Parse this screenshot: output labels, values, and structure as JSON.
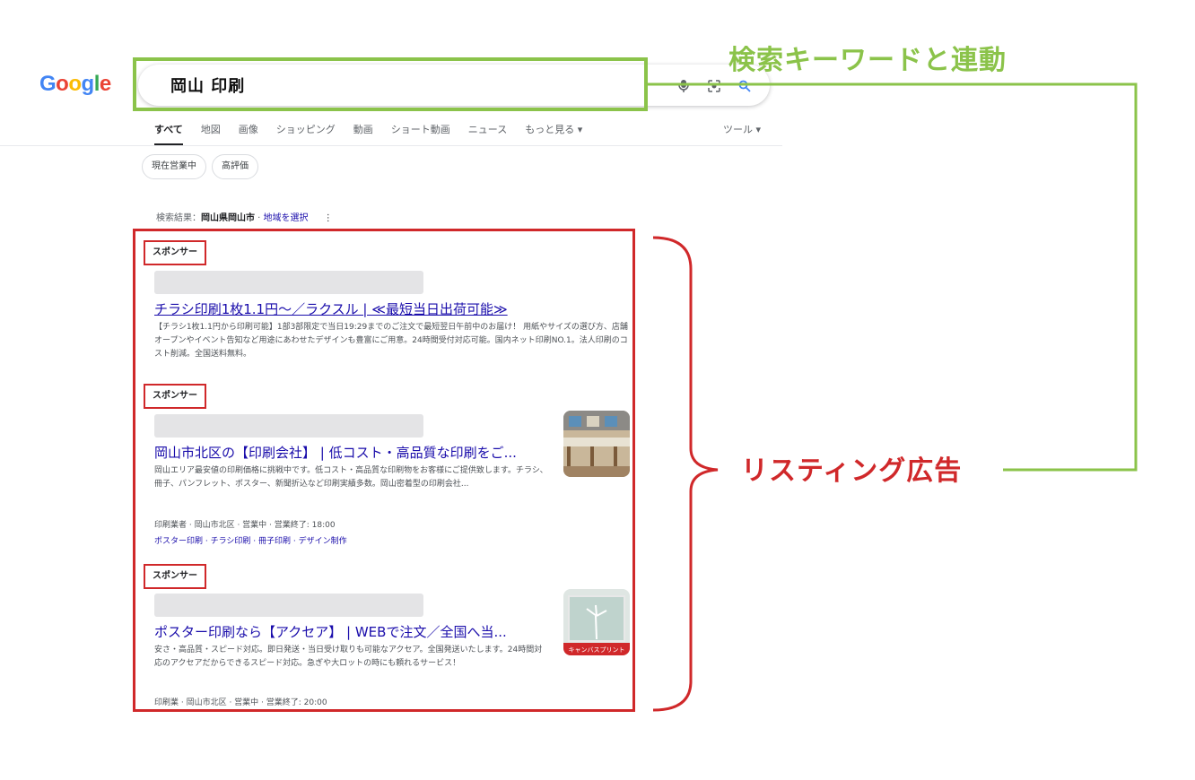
{
  "logo": {
    "text": "Google",
    "letters": [
      {
        "ch": "G",
        "color": "#4285f4"
      },
      {
        "ch": "o",
        "color": "#ea4335"
      },
      {
        "ch": "o",
        "color": "#fbbc05"
      },
      {
        "ch": "g",
        "color": "#4285f4"
      },
      {
        "ch": "l",
        "color": "#34a853"
      },
      {
        "ch": "e",
        "color": "#ea4335"
      }
    ]
  },
  "search": {
    "query": "岡山 印刷",
    "icons": [
      "microphone-icon",
      "camera-lens-icon",
      "search-icon"
    ]
  },
  "tabs": [
    {
      "label": "すべて",
      "active": true
    },
    {
      "label": "地図",
      "active": false
    },
    {
      "label": "画像",
      "active": false
    },
    {
      "label": "ショッピング",
      "active": false
    },
    {
      "label": "動画",
      "active": false
    },
    {
      "label": "ショート動画",
      "active": false
    },
    {
      "label": "ニュース",
      "active": false
    },
    {
      "label": "もっと見る ▾",
      "active": false
    }
  ],
  "tools_label": "ツール ▾",
  "chips": [
    "現在営業中",
    "高評価"
  ],
  "location": {
    "prefix": "検索結果：",
    "place": "岡山県岡山市",
    "separator": " · ",
    "link": "地域を選択",
    "more": "⋮"
  },
  "ads": [
    {
      "sponsor": "スポンサー",
      "title": "チラシ印刷1枚1.1円～／ラクスル | ≪最短当日出荷可能≫",
      "desc": "【チラシ1枚1.1円から印刷可能】1部3部限定で当日19:29までのご注文で最短翌日午前中のお届け！ 用紙やサイズの選び方、店舗オープンやイベント告知など用途にあわせたデザインも豊富にご用意。24時間受付対応可能。国内ネット印刷NO.1。法人印刷のコスト削減。全国送料無料。"
    },
    {
      "sponsor": "スポンサー",
      "title": "岡山市北区の【印刷会社】 | 低コスト・高品質な印刷をご...",
      "desc": "岡山エリア最安値の印刷価格に挑戦中です。低コスト・高品質な印刷物をお客様にご提供致します。チラシ、冊子、パンフレット、ポスター、新聞折込など印刷実績多数。岡山密着型の印刷会社...",
      "meta": "印刷業者 · 岡山市北区 · 営業中 · 営業終了: 18:00",
      "links": "ポスター印刷 · チラシ印刷 · 冊子印刷 · デザイン制作"
    },
    {
      "sponsor": "スポンサー",
      "title": "ポスター印刷なら【アクセア】 | WEBで注文／全国へ当...",
      "desc": "安さ・高品質・スピード対応。即日発送・当日受け取りも可能なアクセア。全国発送いたします。24時間対応のアクセアだからできるスピード対応。急ぎや大ロットの時にも頼れるサービス！",
      "meta": "印刷業 · 岡山市北区 · 営業中 · 営業終了: 20:00",
      "thumb_label": "キャンバスプリント"
    }
  ],
  "annotations": {
    "keyword_link": "検索キーワードと連動",
    "listing_ads": "リスティング広告",
    "green": "#8bc34a",
    "red": "#d0282a"
  }
}
